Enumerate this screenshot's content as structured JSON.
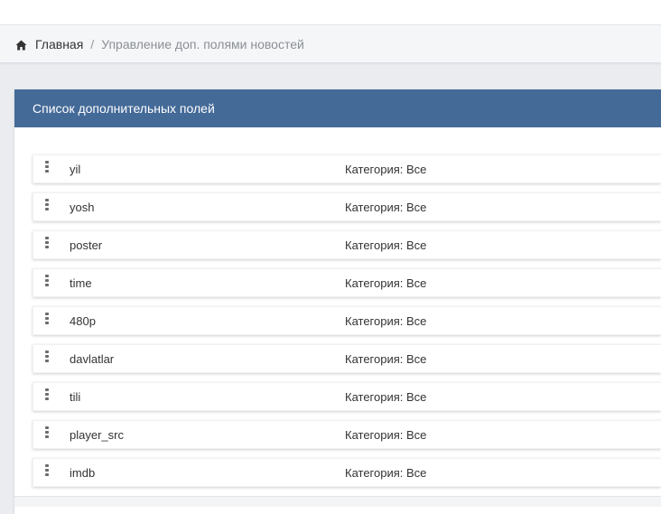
{
  "breadcrumb": {
    "home_label": "Главная",
    "separator": "/",
    "current_label": "Управление доп. полями новостей"
  },
  "panel": {
    "title": "Список дополнительных полей"
  },
  "fields": [
    {
      "name": "yil",
      "category": "Категория: Все"
    },
    {
      "name": "yosh",
      "category": "Категория: Все"
    },
    {
      "name": "poster",
      "category": "Категория: Все"
    },
    {
      "name": "time",
      "category": "Категория: Все"
    },
    {
      "name": "480p",
      "category": "Категория: Все"
    },
    {
      "name": "davlatlar",
      "category": "Категория: Все"
    },
    {
      "name": "tili",
      "category": "Категория: Все"
    },
    {
      "name": "player_src",
      "category": "Категория: Все"
    },
    {
      "name": "imdb",
      "category": "Категория: Все"
    }
  ],
  "colors": {
    "panel_header": "#446a98",
    "page_background": "#eaecf0"
  },
  "icons": {
    "home": "home-icon",
    "drag": "drag-handle-icon"
  }
}
